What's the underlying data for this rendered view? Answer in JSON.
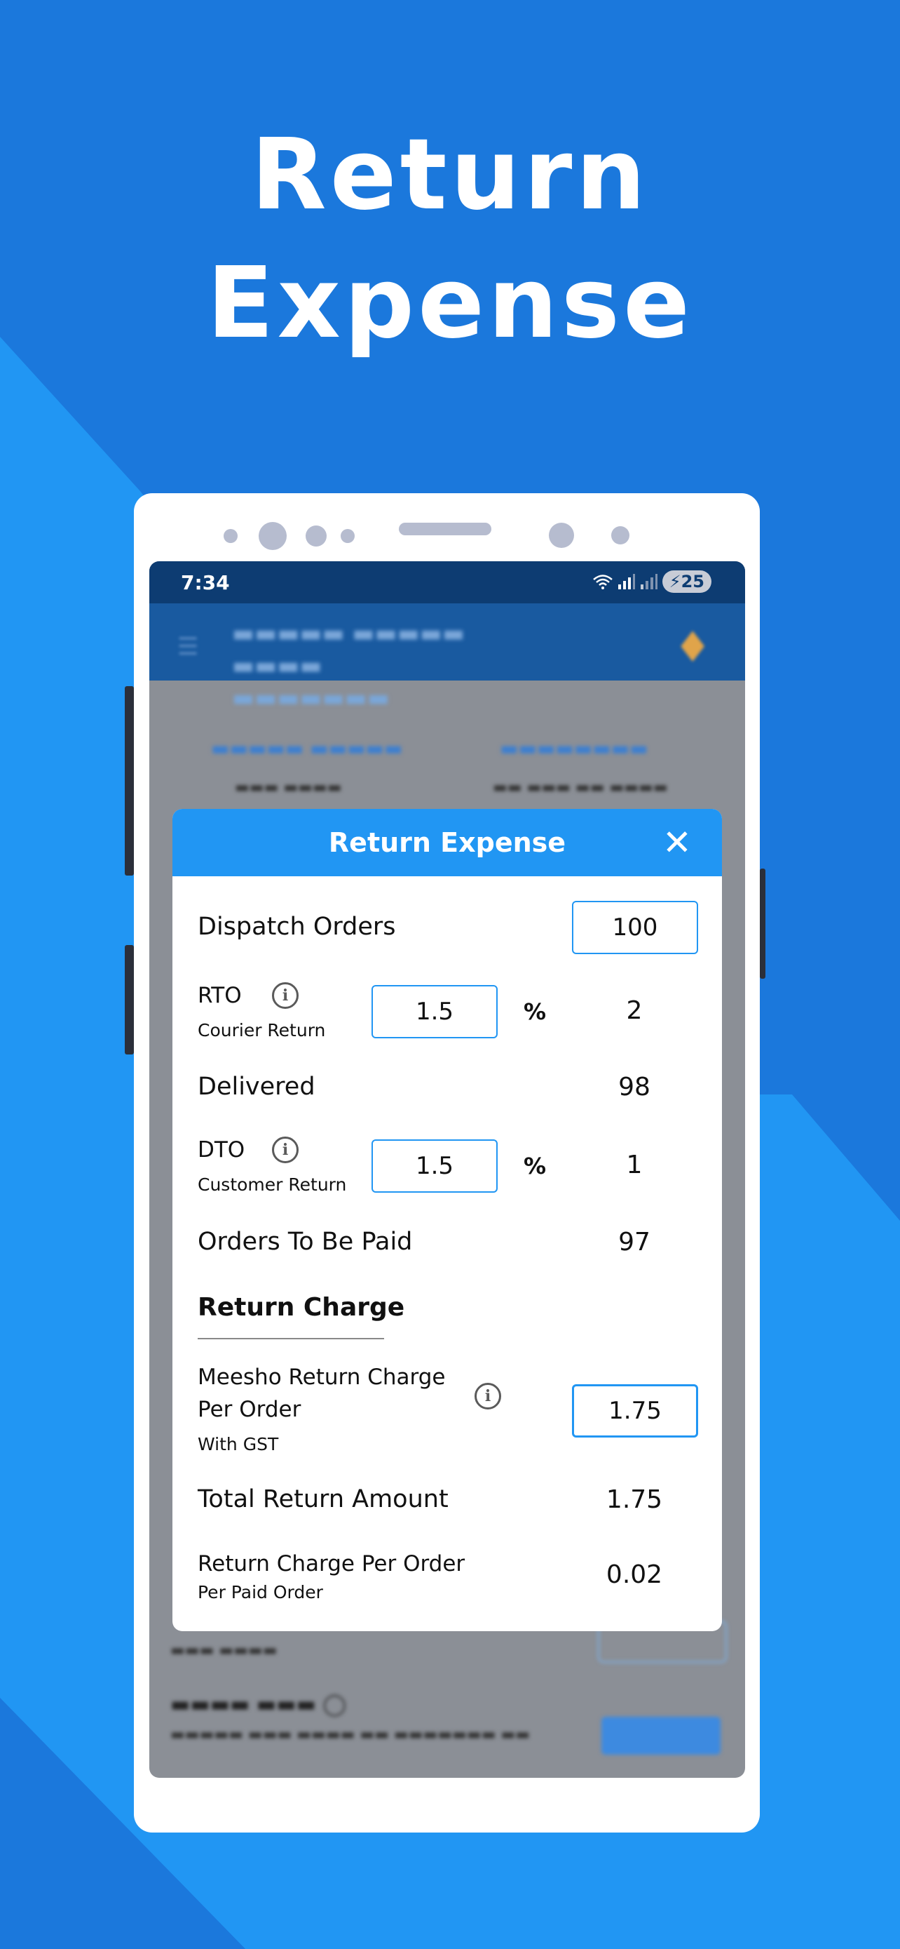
{
  "hero": {
    "line1": "Return",
    "line2": "Expense"
  },
  "colors": {
    "background": "#1f7ee0",
    "accent": "#2196f3",
    "status_bar": "#0d3c72"
  },
  "status_bar": {
    "time": "7:34",
    "battery": "25",
    "icons": [
      "wifi-icon",
      "signal-icon",
      "signal-icon",
      "charging-icon"
    ]
  },
  "dialog": {
    "title": "Return Expense",
    "close_icon": "close-icon",
    "dispatch_orders": {
      "label": "Dispatch Orders",
      "value": "100"
    },
    "rto": {
      "label": "RTO",
      "sublabel": "Courier Return",
      "input": "1.5",
      "unit": "%",
      "result": "2"
    },
    "delivered": {
      "label": "Delivered",
      "value": "98"
    },
    "dto": {
      "label": "DTO",
      "sublabel": "Customer Return",
      "input": "1.5",
      "unit": "%",
      "result": "1"
    },
    "orders_to_be_paid": {
      "label": "Orders To Be Paid",
      "value": "97"
    },
    "section_return_charge": "Return Charge",
    "meesho_return_charge": {
      "label_line1": "Meesho Return Charge",
      "label_line2": "Per Order",
      "sublabel": "With GST",
      "input": "1.75"
    },
    "total_return_amount": {
      "label": "Total Return Amount",
      "value": "1.75"
    },
    "return_charge_per_order": {
      "label": "Return Charge Per Order",
      "sublabel": "Per Paid Order",
      "value": "0.02"
    }
  }
}
